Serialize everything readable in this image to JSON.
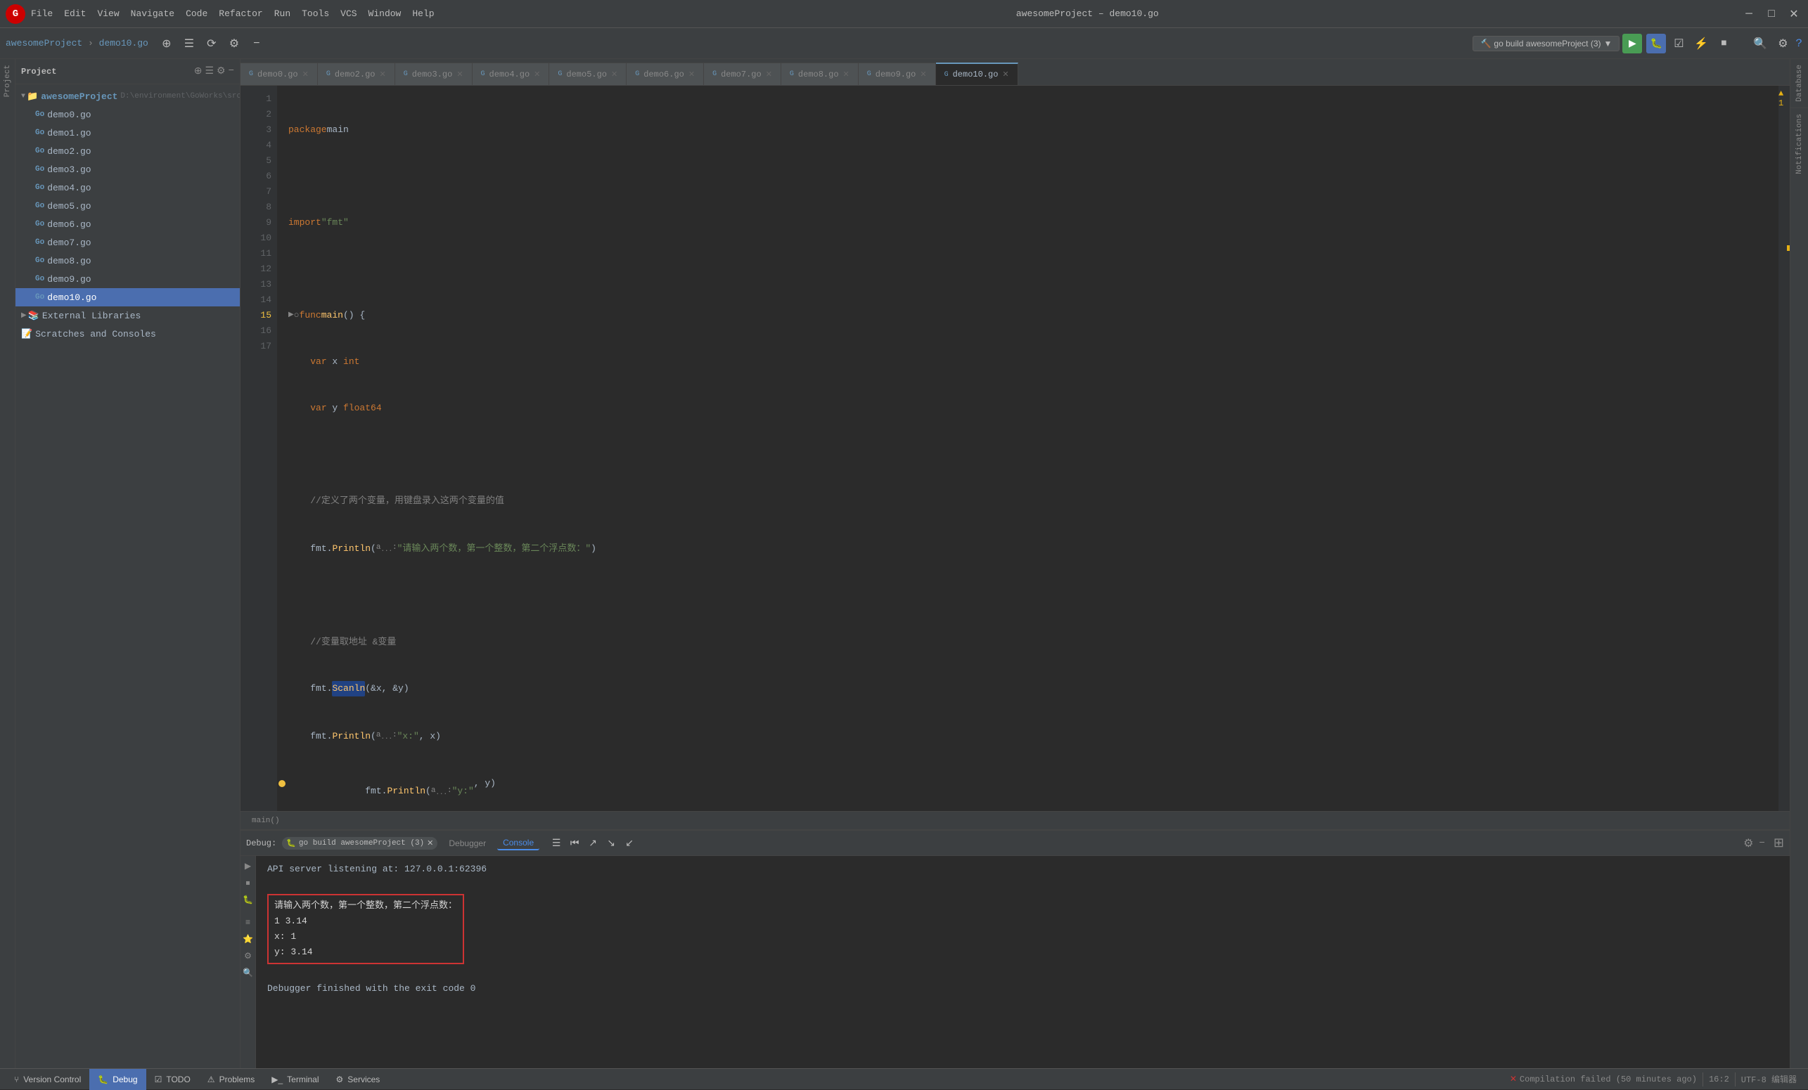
{
  "titleBar": {
    "menus": [
      "File",
      "Edit",
      "View",
      "Navigate",
      "Code",
      "Refactor",
      "Run",
      "Tools",
      "VCS",
      "Window",
      "Help"
    ],
    "title": "awesomeProject – demo10.go",
    "controls": [
      "─",
      "□",
      "✕"
    ]
  },
  "toolbar": {
    "breadcrumb": [
      "awesomeProject",
      "demo10.go"
    ],
    "buildBtn": "go build awesomeProject (3)",
    "runBtn": "▶",
    "buildBtn2": "▶",
    "updateBtn": "⟳"
  },
  "sidebar": {
    "header": "Project",
    "items": [
      {
        "label": "awesomeProject",
        "type": "root",
        "path": "D:\\environment\\GoWorks\\src\\awes",
        "expanded": true
      },
      {
        "label": "demo0.go",
        "type": "go"
      },
      {
        "label": "demo1.go",
        "type": "go"
      },
      {
        "label": "demo2.go",
        "type": "go"
      },
      {
        "label": "demo3.go",
        "type": "go"
      },
      {
        "label": "demo4.go",
        "type": "go"
      },
      {
        "label": "demo5.go",
        "type": "go"
      },
      {
        "label": "demo6.go",
        "type": "go"
      },
      {
        "label": "demo7.go",
        "type": "go"
      },
      {
        "label": "demo8.go",
        "type": "go"
      },
      {
        "label": "demo9.go",
        "type": "go"
      },
      {
        "label": "demo10.go",
        "type": "go",
        "selected": true
      },
      {
        "label": "External Libraries",
        "type": "ext"
      },
      {
        "label": "Scratches and Consoles",
        "type": "scratch"
      }
    ]
  },
  "tabs": [
    {
      "label": "demo0.go",
      "active": false
    },
    {
      "label": "demo2.go",
      "active": false
    },
    {
      "label": "demo3.go",
      "active": false
    },
    {
      "label": "demo4.go",
      "active": false
    },
    {
      "label": "demo5.go",
      "active": false
    },
    {
      "label": "demo6.go",
      "active": false
    },
    {
      "label": "demo7.go",
      "active": false
    },
    {
      "label": "demo8.go",
      "active": false
    },
    {
      "label": "demo9.go",
      "active": false
    },
    {
      "label": "demo10.go",
      "active": true
    }
  ],
  "editor": {
    "lines": [
      {
        "num": 1,
        "content": "package main",
        "type": "normal"
      },
      {
        "num": 2,
        "content": "",
        "type": "normal"
      },
      {
        "num": 3,
        "content": "import \"fmt\"",
        "type": "normal"
      },
      {
        "num": 4,
        "content": "",
        "type": "normal"
      },
      {
        "num": 5,
        "content": "func main() {",
        "type": "func"
      },
      {
        "num": 6,
        "content": "    var x int",
        "type": "normal"
      },
      {
        "num": 7,
        "content": "    var y float64",
        "type": "normal"
      },
      {
        "num": 8,
        "content": "",
        "type": "normal"
      },
      {
        "num": 9,
        "content": "    //定义了两个变量，用键盘录入这两个变量的值",
        "type": "comment"
      },
      {
        "num": 10,
        "content": "    fmt.Println( a...: \"请输入两个数，第一个整数，第二个浮点数：\")",
        "type": "normal"
      },
      {
        "num": 11,
        "content": "",
        "type": "normal"
      },
      {
        "num": 12,
        "content": "    //变量取地址 &变量",
        "type": "comment"
      },
      {
        "num": 13,
        "content": "    fmt.Scanln(&x, &y)",
        "type": "normal",
        "highlight": "Scanln"
      },
      {
        "num": 14,
        "content": "    fmt.Println( a...: \"x:\", x)",
        "type": "normal"
      },
      {
        "num": 15,
        "content": "    fmt.Println( a...: \"y:\", y)",
        "type": "normal",
        "debugDot": true
      },
      {
        "num": 16,
        "content": "}",
        "type": "normal"
      },
      {
        "num": 17,
        "content": "",
        "type": "normal"
      }
    ],
    "breadcrumb": "main()"
  },
  "debugPanel": {
    "label": "Debug:",
    "tag": "go build awesomeProject (3)",
    "tabs": [
      "Debugger",
      "Console"
    ],
    "activeTab": "Console",
    "output": [
      "API server listening at: 127.0.0.1:62396",
      "",
      "请输入两个数，第一个整数，第二个浮点数：",
      "1 3.14",
      "x: 1",
      "y: 3.14",
      "",
      "Debugger finished with the exit code 0"
    ],
    "highlightedLines": [
      2,
      3,
      4,
      5
    ]
  },
  "statusBar": {
    "versionControl": "Version Control",
    "debug": "Debug",
    "todo": "TODO",
    "problems": "Problems",
    "terminal": "Terminal",
    "services": "Services",
    "position": "16:2",
    "encoding": "UTF-8 编辑器",
    "errorMsg": "Compilation failed (50 minutes ago)"
  },
  "rightSidebar": {
    "items": [
      "Database",
      "Notifications"
    ]
  }
}
